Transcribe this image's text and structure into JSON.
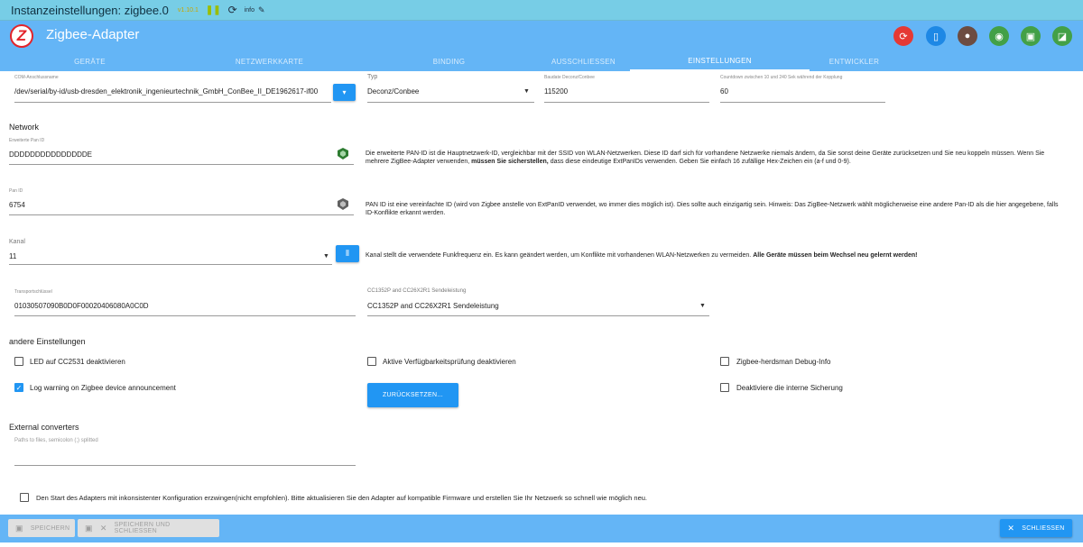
{
  "titlebar": {
    "title": "Instanzeinstellungen: zigbee.0",
    "version": "v1.10.1",
    "log_level": "info"
  },
  "app": {
    "name": "Zigbee-Adapter",
    "logo_letter": "Z"
  },
  "tabs": [
    "GERÄTE",
    "NETZWERKKARTE",
    "BINDING",
    "AUSSCHLIESSEN",
    "EINSTELLUNGEN",
    "ENTWICKLER"
  ],
  "active_tab": "EINSTELLUNGEN",
  "header_icons": [
    {
      "name": "refresh-icon",
      "color": "#e53935"
    },
    {
      "name": "phone-icon",
      "color": "#1e88e5"
    },
    {
      "name": "cookie-icon",
      "color": "#6d4c41"
    },
    {
      "name": "wifi-icon",
      "color": "#43a047"
    },
    {
      "name": "chip-icon",
      "color": "#43a047"
    },
    {
      "name": "signal-icon",
      "color": "#43a047"
    }
  ],
  "settings": {
    "com": {
      "label": "COM-Anschlussname",
      "value": "/dev/serial/by-id/usb-dresden_elektronik_ingenieurtechnik_GmbH_ConBee_II_DE1962617-if00"
    },
    "typ": {
      "label": "Typ",
      "value": "Deconz/Conbee"
    },
    "baud": {
      "label": "Baudate Deconz/Conbee",
      "value": "115200"
    },
    "countdown": {
      "label": "Countdown zwischen 10 und 240 Sek während der Kopplung",
      "value": "60"
    }
  },
  "network": {
    "heading": "Network",
    "ext_pan": {
      "label": "Erweiterte Pan ID",
      "value": "DDDDDDDDDDDDDDDE",
      "desc_a": "Die erweiterte PAN-ID ist die Hauptnetzwerk-ID, vergleichbar mit der SSID von WLAN-Netzwerken. Diese ID darf sich für vorhandene Netzwerke niemals ändern, da Sie sonst deine Geräte zurücksetzen und Sie neu koppeln müssen. Wenn Sie mehrere ZigBee-Adapter verwenden,",
      "desc_bold": "müssen Sie sicherstellen,",
      "desc_b": "dass diese eindeutige ExtPanIDs verwenden. Geben Sie einfach 16 zufällige Hex-Zeichen ein (a-f und 0-9)."
    },
    "pan": {
      "label": "Pan ID",
      "value": "6754",
      "desc": "PAN ID ist eine vereinfachte ID (wird von Zigbee anstelle von ExtPanID verwendet, wo immer dies möglich ist). Dies sollte auch einzigartig sein. Hinweis: Das ZigBee-Netzwerk wählt möglicherweise eine andere Pan-ID als die hier angegebene, falls ID-Konflikte erkannt werden."
    },
    "channel": {
      "label": "Kanal",
      "value": "11",
      "desc": "Kanal stellt die verwendete Funkfrequenz ein. Es kann geändert werden, um Konflikte mit vorhandenen WLAN-Netzwerken zu vermeiden.",
      "desc_bold": "Alle Geräte müssen beim Wechsel neu gelernt werden!"
    },
    "transport": {
      "label": "Transportschlüssel",
      "value": "01030507090B0D0F00020406080A0C0D"
    },
    "power": {
      "label": "CC1352P and CC26X2R1 Sendeleistung",
      "value": "CC1352P and CC26X2R1 Sendeleistung"
    }
  },
  "other": {
    "heading": "andere Einstellungen",
    "led": "LED auf CC2531 deaktivieren",
    "avail": "Aktive Verfügbarkeitsprüfung deaktivieren",
    "debug": "Zigbee-herdsman Debug-Info",
    "logwarn": "Log warning on Zigbee device announcement",
    "reset_button": "ZURÜCKSETZEN...",
    "backup": "Deaktiviere die interne Sicherung"
  },
  "external": {
    "heading": "External converters",
    "placeholder": "Paths to files, semicolon (;) splitted"
  },
  "force_start": "Den Start des Adapters mit inkonsistenter Konfiguration erzwingen(nicht empfohlen). Bitte aktualisieren Sie den Adapter auf kompatible Firmware und erstellen Sie Ihr Netzwerk so schnell wie möglich neu.",
  "footer": {
    "save": "SPEICHERN",
    "save_close": "SPEICHERN UND SCHLIESSEN",
    "close": "SCHLIESSEN"
  }
}
